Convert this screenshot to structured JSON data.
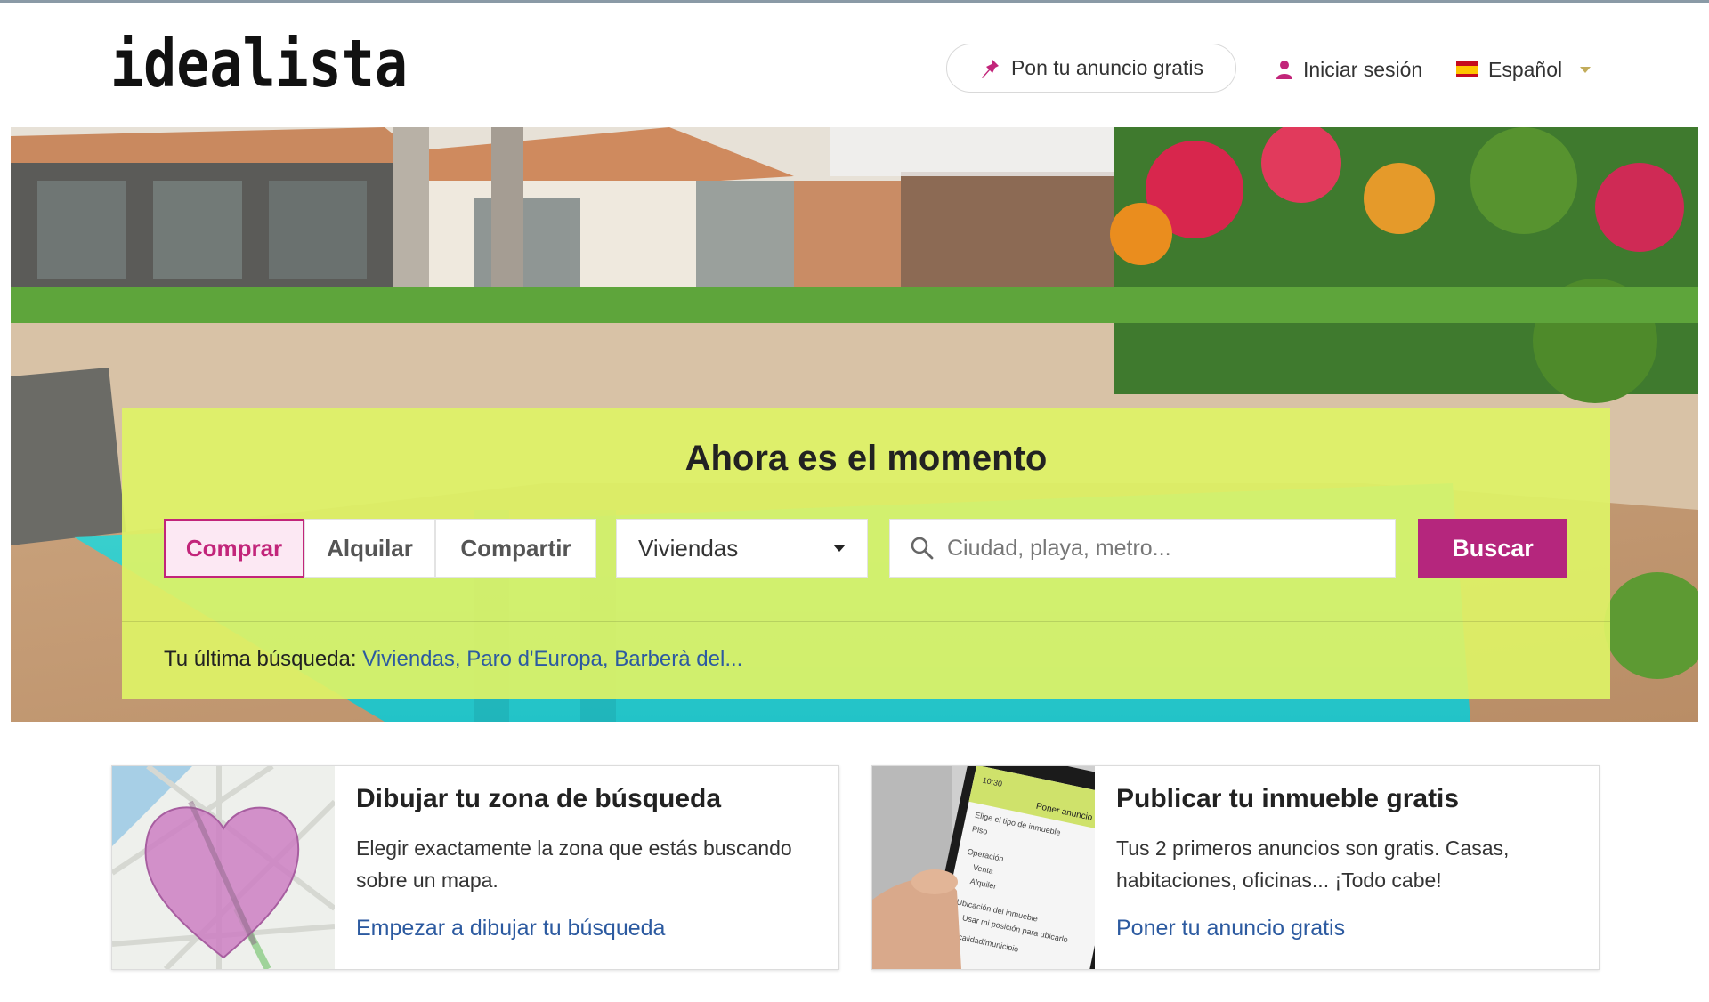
{
  "header": {
    "logo_text": "idealista",
    "post_ad_label": "Pon tu anuncio gratis",
    "login_label": "Iniciar sesión",
    "language_label": "Español"
  },
  "search": {
    "title": "Ahora es el momento",
    "tabs": [
      {
        "label": "Comprar",
        "active": true
      },
      {
        "label": "Alquilar",
        "active": false
      },
      {
        "label": "Compartir",
        "active": false
      }
    ],
    "property_type": "Viviendas",
    "placeholder": "Ciudad, playa, metro...",
    "button_label": "Buscar",
    "last_search_label": "Tu última búsqueda:",
    "last_search_value": "Viviendas, Paro d'Europa, Barberà del..."
  },
  "cards": [
    {
      "title": "Dibujar tu zona de búsqueda",
      "text": "Elegir exactamente la zona que estás buscando sobre un mapa.",
      "link": "Empezar a dibujar tu búsqueda"
    },
    {
      "title": "Publicar tu inmueble gratis",
      "text": "Tus 2 primeros anuncios son gratis. Casas, habitaciones, oficinas... ¡Todo cabe!",
      "link": "Poner tu anuncio gratis"
    }
  ],
  "phone_mockup": {
    "time": "10:30",
    "header": "Poner anuncio",
    "lines": [
      "Elige el tipo de inmueble",
      "Piso",
      "Operación",
      "Venta",
      "Alquiler",
      "Ubicación del inmueble",
      "Usar mi posición para ubicarlo",
      "Localidad/municipio"
    ]
  },
  "colors": {
    "brand_magenta": "#b5267d",
    "panel_lime": "#def266",
    "link_blue": "#2c5aa0"
  },
  "icons": {
    "post_ad": "pin-icon",
    "login": "user-icon",
    "search": "search-icon",
    "language": "spain-flag-icon"
  }
}
